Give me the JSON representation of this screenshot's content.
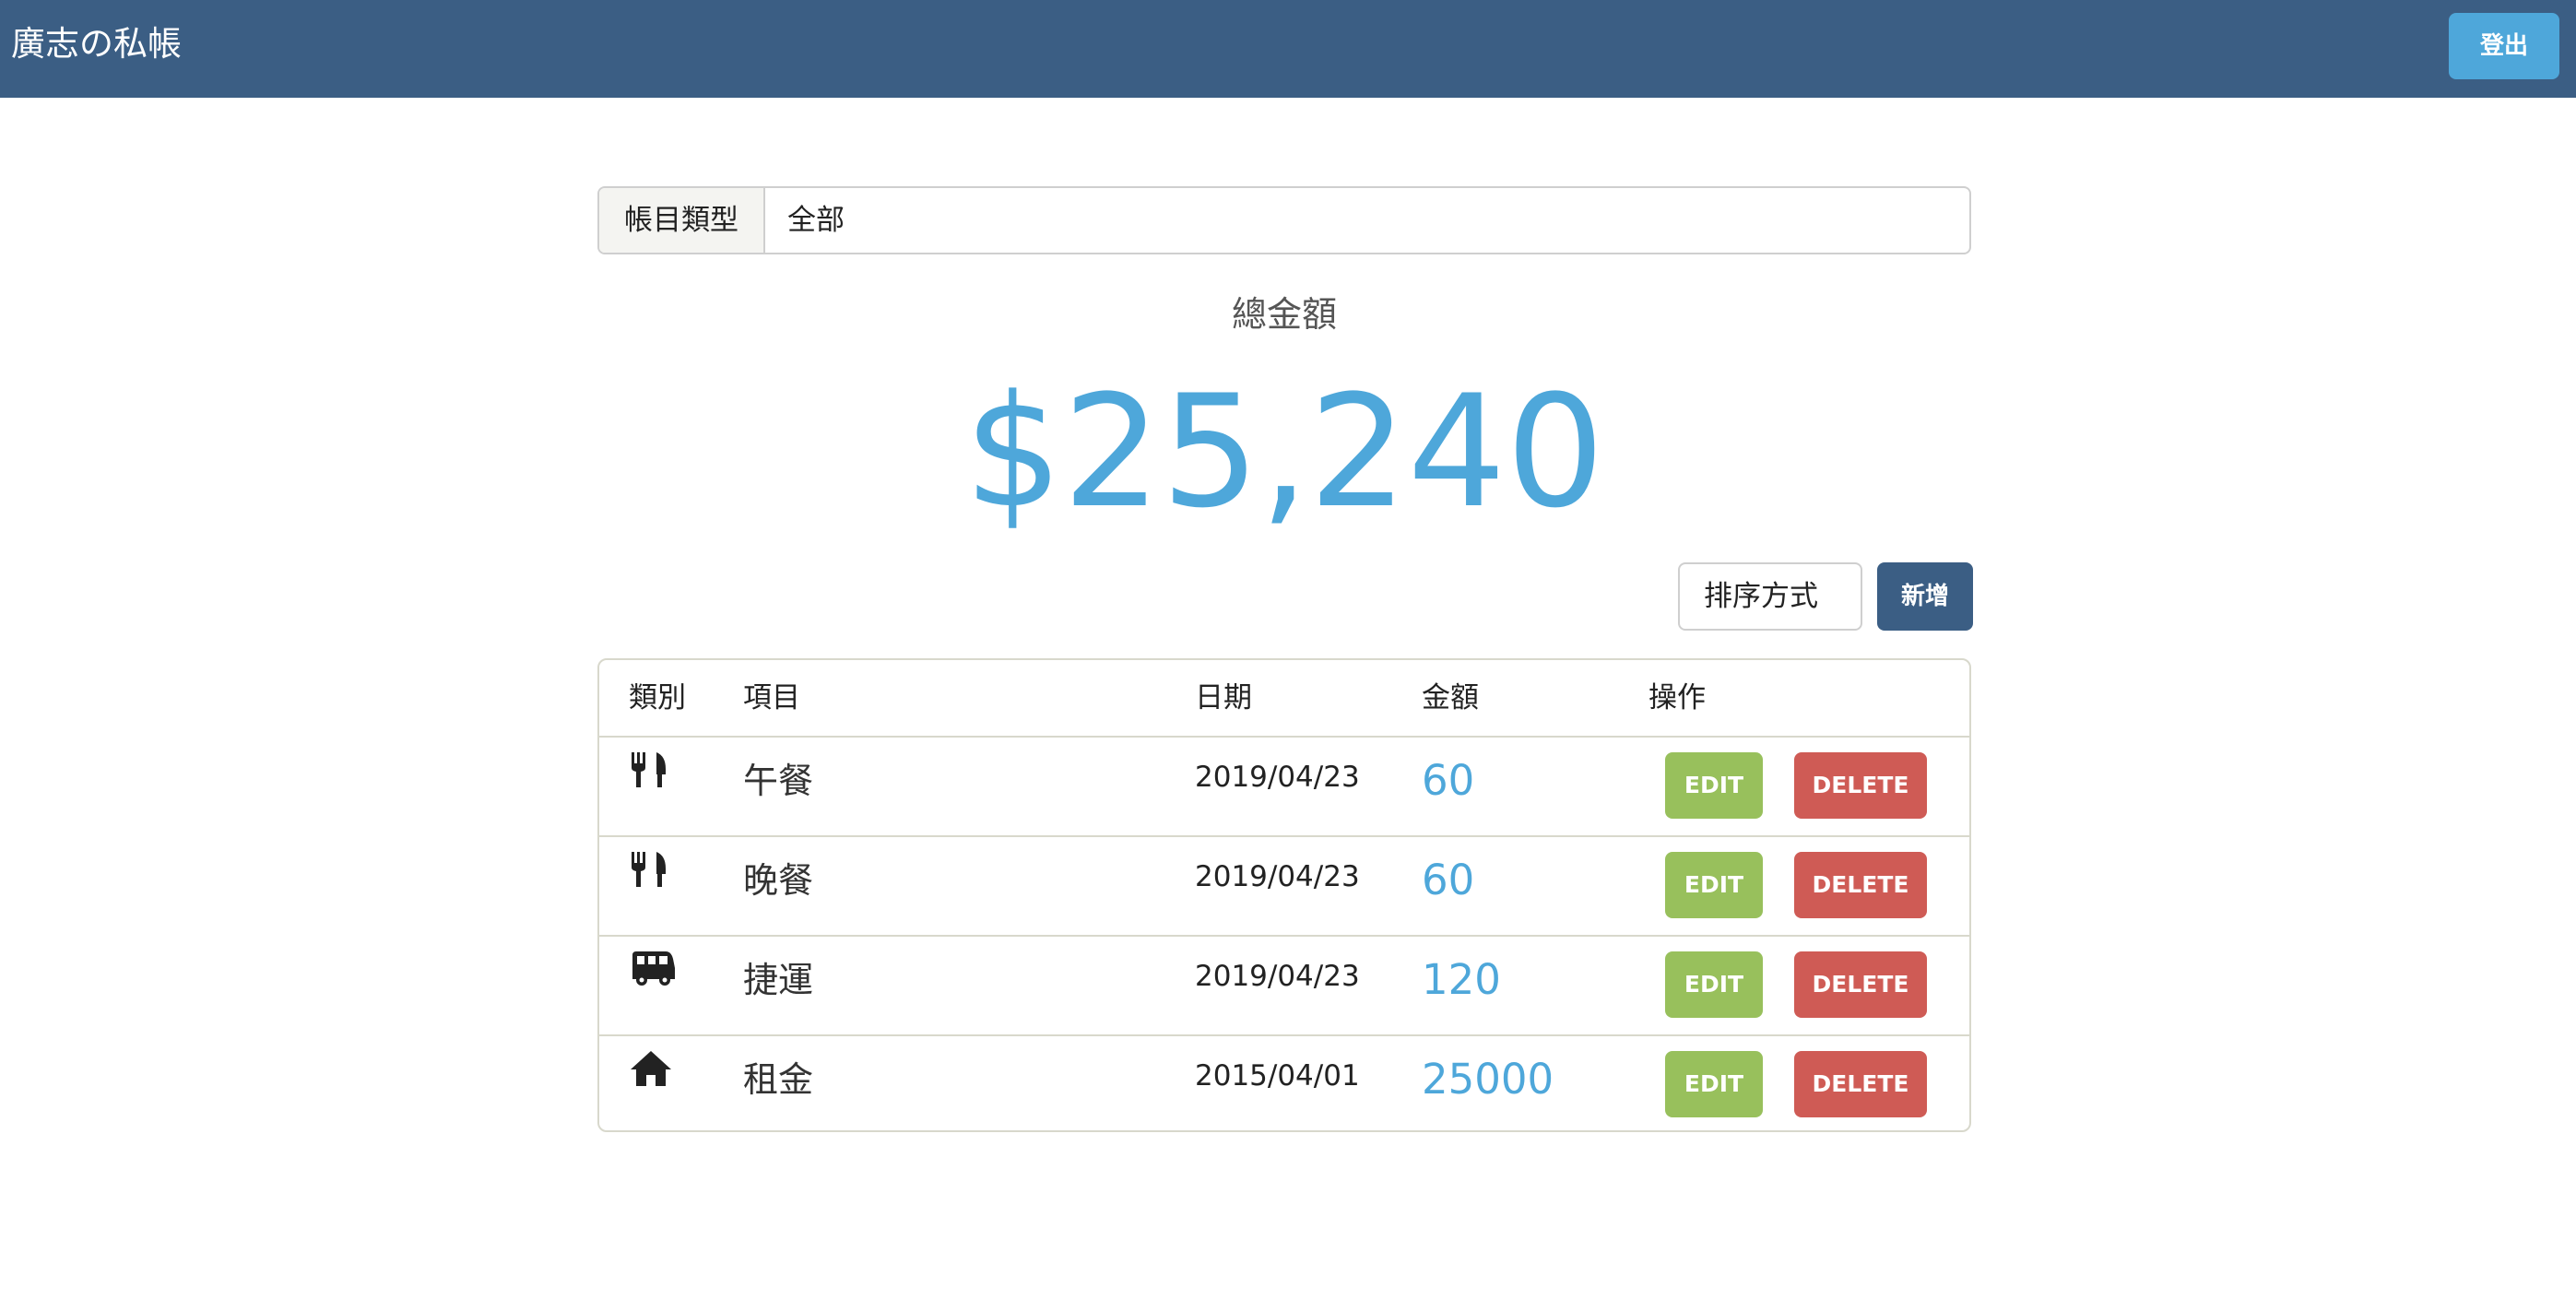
{
  "navbar": {
    "brand": "廣志の私帳",
    "logout_label": "登出"
  },
  "filter": {
    "label": "帳目類型",
    "value": "全部"
  },
  "summary": {
    "total_label": "總金額",
    "total_value": "$25,240"
  },
  "controls": {
    "sort_label": "排序方式",
    "add_label": "新增"
  },
  "table": {
    "headers": [
      "類別",
      "項目",
      "日期",
      "金額",
      "操作"
    ],
    "rows": [
      {
        "icon": "utensils-icon",
        "item": "午餐",
        "date": "2019/04/23",
        "amount": "60",
        "edit": "EDIT",
        "delete": "DELETE"
      },
      {
        "icon": "utensils-icon",
        "item": "晚餐",
        "date": "2019/04/23",
        "amount": "60",
        "edit": "EDIT",
        "delete": "DELETE"
      },
      {
        "icon": "bus-icon",
        "item": "捷運",
        "date": "2019/04/23",
        "amount": "120",
        "edit": "EDIT",
        "delete": "DELETE"
      },
      {
        "icon": "home-icon",
        "item": "租金",
        "date": "2015/04/01",
        "amount": "25000",
        "edit": "EDIT",
        "delete": "DELETE"
      }
    ]
  },
  "colors": {
    "navbar": "#3b5e84",
    "accent": "#4ea7da",
    "edit": "#98c05c",
    "delete": "#cf5b55"
  }
}
